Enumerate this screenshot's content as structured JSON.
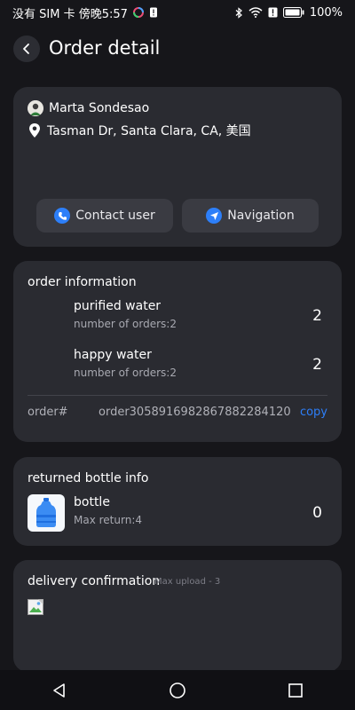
{
  "status_bar": {
    "left_text": "没有 SIM 卡 傍晚5:57",
    "battery_percent": "100%"
  },
  "header": {
    "title": "Order detail"
  },
  "user": {
    "name": "Marta Sondesao",
    "address": "Tasman Dr, Santa Clara, CA, 美国",
    "contact_label": "Contact user",
    "navigation_label": "Navigation"
  },
  "order_info": {
    "title": "order information",
    "items": [
      {
        "name": "purified water",
        "meta": "number of orders:2",
        "qty": "2"
      },
      {
        "name": "happy water",
        "meta": "number of orders:2",
        "qty": "2"
      }
    ],
    "order_label": "order#",
    "order_value": "order3058916982867882284120",
    "copy_label": "copy"
  },
  "bottle_info": {
    "title": "returned bottle info",
    "name": "bottle",
    "meta": "Max return:4",
    "qty": "0"
  },
  "delivery": {
    "title": "delivery confirmation",
    "hint": "Max upload - 3"
  },
  "colors": {
    "background": "#16161a",
    "card": "#2a2b31",
    "accent": "#2d7ff9"
  }
}
